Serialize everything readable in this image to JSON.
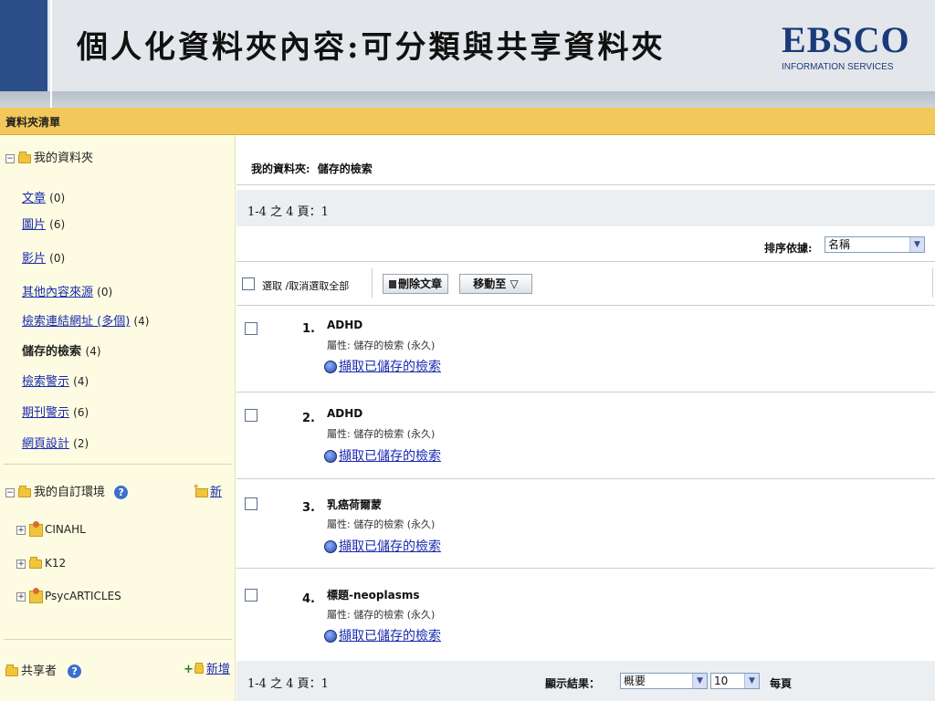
{
  "slide": {
    "title": "個人化資料夾內容:可分類與共享資料夾",
    "logo_main": "EBSCO",
    "logo_sub": "INFORMATION SERVICES"
  },
  "folder_bar": {
    "title": "資料夾清單"
  },
  "sidebar": {
    "my_folder": {
      "label": "我的資料夾",
      "items": [
        {
          "label": "文章",
          "count": "(0)",
          "link": true
        },
        {
          "label": "圖片",
          "count": "(6)",
          "link": true
        },
        {
          "label": "影片",
          "count": "(0)",
          "link": true
        },
        {
          "label": "其他內容來源",
          "count": "(0)",
          "link": true
        },
        {
          "label": "檢索連結網址 (多個)",
          "count": "(4)",
          "link": true
        },
        {
          "label": "儲存的檢索",
          "count": "(4)",
          "link": false
        },
        {
          "label": "檢索警示",
          "count": "(4)",
          "link": true
        },
        {
          "label": "期刊警示",
          "count": "(6)",
          "link": true
        },
        {
          "label": "網頁設計",
          "count": "(2)",
          "link": true
        }
      ]
    },
    "custom_env": {
      "label": "我的自訂環境",
      "new_label": "新",
      "children": [
        "CINAHL",
        "K12",
        "PsycARTICLES"
      ]
    },
    "shared": {
      "label": "共享者",
      "add_label": "新增"
    }
  },
  "main": {
    "breadcrumb_label": "我的資料夾:",
    "breadcrumb_value": "儲存的檢索",
    "pagination_top": "1-4 之 4  頁：1",
    "sort_label": "排序依據:",
    "sort_value": "名稱",
    "select_all_label": "選取 /取消選取全部",
    "delete_button": "刪除文章",
    "move_button": "移動至",
    "move_arrow": "▽",
    "items": [
      {
        "num": "1.",
        "title": "ADHD",
        "attr": "屬性: 儲存的檢索 (永久)",
        "link": "擷取已儲存的檢索"
      },
      {
        "num": "2.",
        "title": "ADHD",
        "attr": "屬性: 儲存的檢索 (永久)",
        "link": "擷取已儲存的檢索"
      },
      {
        "num": "3.",
        "title": "乳癌荷爾蒙",
        "attr": "屬性: 儲存的檢索 (永久)",
        "link": "擷取已儲存的檢索"
      },
      {
        "num": "4.",
        "title": "標題-neoplasms",
        "attr": "屬性: 儲存的檢索 (永久)",
        "link": "擷取已儲存的檢索"
      }
    ],
    "pagination_bottom": "1-4 之 4  頁：1",
    "display_results_label": "顯示結果：",
    "display_value": "概要",
    "per_page_value": "10",
    "per_page_label": "每頁"
  }
}
